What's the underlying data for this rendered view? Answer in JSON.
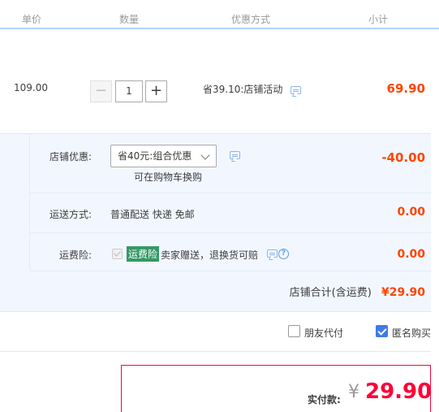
{
  "header": {
    "col_unit_price": "单价",
    "col_quantity": "数量",
    "col_discount": "优惠方式",
    "col_subtotal": "小计"
  },
  "item": {
    "unit_price": "109.00",
    "quantity": "1",
    "minus_label": "−",
    "plus_label": "+",
    "promo_text": "省39.10:店铺活动",
    "subtotal": "69.90"
  },
  "shop_discount": {
    "label": "店铺优惠:",
    "selected_option": "省40元:组合优惠",
    "hint": "可在购物车换购",
    "amount": "-40.00"
  },
  "shipping": {
    "label": "运送方式:",
    "value": "普通配送 快递 免邮",
    "amount": "0.00"
  },
  "shipping_insurance": {
    "label": "运费险:",
    "highlight": "运费险",
    "text": "卖家赠送，退换货可赔",
    "help_glyph": "?",
    "amount": "0.00"
  },
  "shop_total": {
    "label": "店铺合计(含运费)",
    "amount": "¥29.90"
  },
  "options": {
    "friend_pay_label": "朋友代付",
    "friend_pay_checked": false,
    "anonymous_label": "匿名购买",
    "anonymous_checked": true
  },
  "payment": {
    "label": "实付款:",
    "currency": "¥",
    "amount": "29.90"
  },
  "colors": {
    "price_red": "#ff0036",
    "accent_blue": "#3d7ce8",
    "panel_bg": "#f2f7ff",
    "highlight_green": "#339966"
  }
}
